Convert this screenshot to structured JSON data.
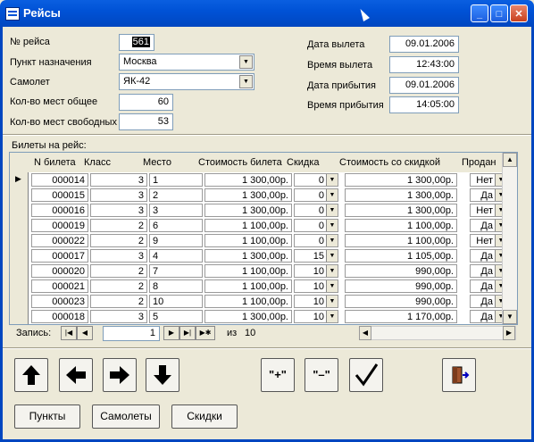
{
  "window": {
    "title": "Рейсы"
  },
  "form": {
    "flight_no_label": "№ рейса",
    "flight_no": "561",
    "destination_label": "Пункт назначения",
    "destination": "Москва",
    "plane_label": "Самолет",
    "plane": "ЯК-42",
    "seats_total_label": "Кол-во мест общее",
    "seats_total": "60",
    "seats_free_label": "Кол-во мест свободных",
    "seats_free": "53",
    "dep_date_label": "Дата вылета",
    "dep_date": "09.01.2006",
    "dep_time_label": "Время вылета",
    "dep_time": "12:43:00",
    "arr_date_label": "Дата прибытия",
    "arr_date": "09.01.2006",
    "arr_time_label": "Время прибытия",
    "arr_time": "14:05:00"
  },
  "tickets": {
    "caption": "Билеты на рейс:",
    "columns": [
      "N билета",
      "Класс",
      "Место",
      "Стоимость билета",
      "Скидка",
      "Стоимость со скидкой",
      "Продан"
    ],
    "rows": [
      [
        "000014",
        "3",
        "1",
        "1 300,00р.",
        "0",
        "1 300,00р.",
        "Нет"
      ],
      [
        "000015",
        "3",
        "2",
        "1 300,00р.",
        "0",
        "1 300,00р.",
        "Да"
      ],
      [
        "000016",
        "3",
        "3",
        "1 300,00р.",
        "0",
        "1 300,00р.",
        "Нет"
      ],
      [
        "000019",
        "2",
        "6",
        "1 100,00р.",
        "0",
        "1 100,00р.",
        "Да"
      ],
      [
        "000022",
        "2",
        "9",
        "1 100,00р.",
        "0",
        "1 100,00р.",
        "Нет"
      ],
      [
        "000017",
        "3",
        "4",
        "1 300,00р.",
        "15",
        "1 105,00р.",
        "Да"
      ],
      [
        "000020",
        "2",
        "7",
        "1 100,00р.",
        "10",
        "990,00р.",
        "Да"
      ],
      [
        "000021",
        "2",
        "8",
        "1 100,00р.",
        "10",
        "990,00р.",
        "Да"
      ],
      [
        "000023",
        "2",
        "10",
        "1 100,00р.",
        "10",
        "990,00р.",
        "Да"
      ],
      [
        "000018",
        "3",
        "5",
        "1 300,00р.",
        "10",
        "1 170,00р.",
        "Да"
      ]
    ]
  },
  "navigator": {
    "label": "Запись:",
    "current": "1",
    "of_label": "из",
    "total": "10"
  },
  "buttons": {
    "points": "Пункты",
    "planes": "Самолеты",
    "discounts": "Скидки",
    "plus": "\"+\"",
    "minus": "\"–\""
  }
}
